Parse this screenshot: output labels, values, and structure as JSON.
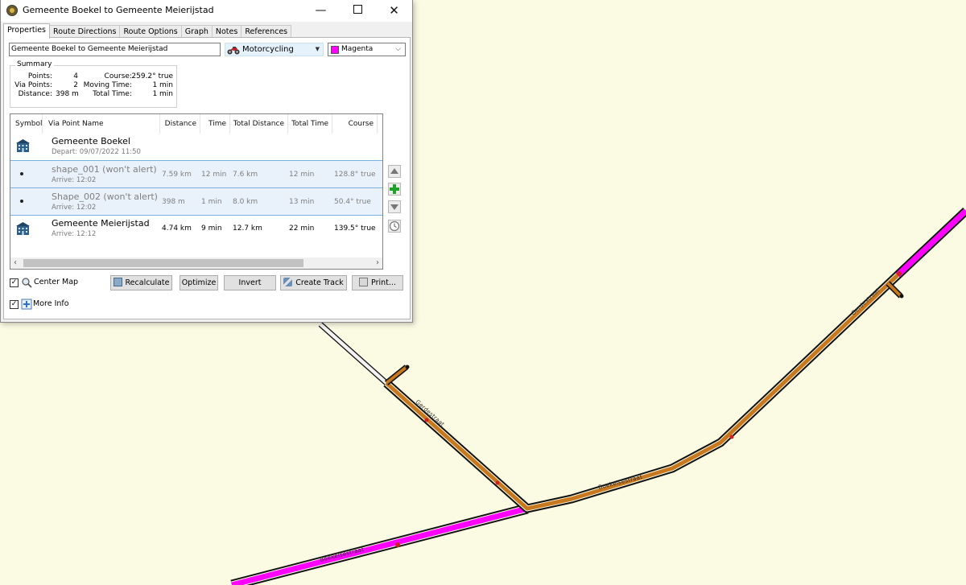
{
  "window": {
    "title": "Gemeente Boekel to Gemeente Meierijstad",
    "minimize": "—",
    "close": "✕"
  },
  "tabs": [
    "Properties",
    "Route Directions",
    "Route Options",
    "Graph",
    "Notes",
    "References"
  ],
  "properties": {
    "route_name": "Gemeente Boekel to Gemeente Meierijstad",
    "mode": "Motorcycling",
    "color_name": "Magenta",
    "color_hex": "#ff00ff"
  },
  "summary": {
    "title": "Summary",
    "points_label": "Points:",
    "points": "4",
    "via_label": "Via Points:",
    "via": "2",
    "distance_label": "Distance:",
    "distance": "398 m",
    "course_label": "Course:",
    "course": "259.2° true",
    "moving_label": "Moving Time:",
    "moving": "1 min",
    "total_label": "Total Time:",
    "total": "1 min"
  },
  "grid": {
    "headers": [
      "Symbol",
      "Via Point Name",
      "Distance",
      "Time",
      "Total Distance",
      "Total Time",
      "Course"
    ],
    "rows": [
      {
        "name": "Gemeente Boekel",
        "sub": "Depart: 09/07/2022 11:50",
        "distance": "",
        "time": "",
        "total_distance": "",
        "total_time": "",
        "course": "",
        "symbol": "building-icon"
      },
      {
        "name": "shape_001 (won't alert)",
        "sub": "Arrive: 12:02",
        "distance": "7.59 km",
        "time": "12 min",
        "total_distance": "7.6 km",
        "total_time": "12 min",
        "course": "128.8° true",
        "symbol": "dot-icon"
      },
      {
        "name": "Shape_002 (won't alert)",
        "sub": "Arrive: 12:02",
        "distance": "398 m",
        "time": "1 min",
        "total_distance": "8.0 km",
        "total_time": "13 min",
        "course": "50.4° true",
        "symbol": "dot-icon"
      },
      {
        "name": "Gemeente Meierijstad",
        "sub": "Arrive: 12:12",
        "distance": "4.74 km",
        "time": "9 min",
        "total_distance": "12.7 km",
        "total_time": "22 min",
        "course": "139.5° true",
        "symbol": "building-icon"
      }
    ]
  },
  "buttons": {
    "center_map": "Center Map",
    "more_info": "More Info",
    "recalculate": "Recalculate",
    "optimize": "Optimize",
    "invert": "Invert",
    "create_track": "Create Track",
    "print": "Print..."
  },
  "map": {
    "background": "#fbfbe4",
    "route_color": "#c8781e",
    "highlight_color": "#ff00ff",
    "road_labels": [
      "Gerdestraat",
      "Gerdestraat",
      "Boekelsestraat",
      "Boekelsestraat"
    ]
  }
}
